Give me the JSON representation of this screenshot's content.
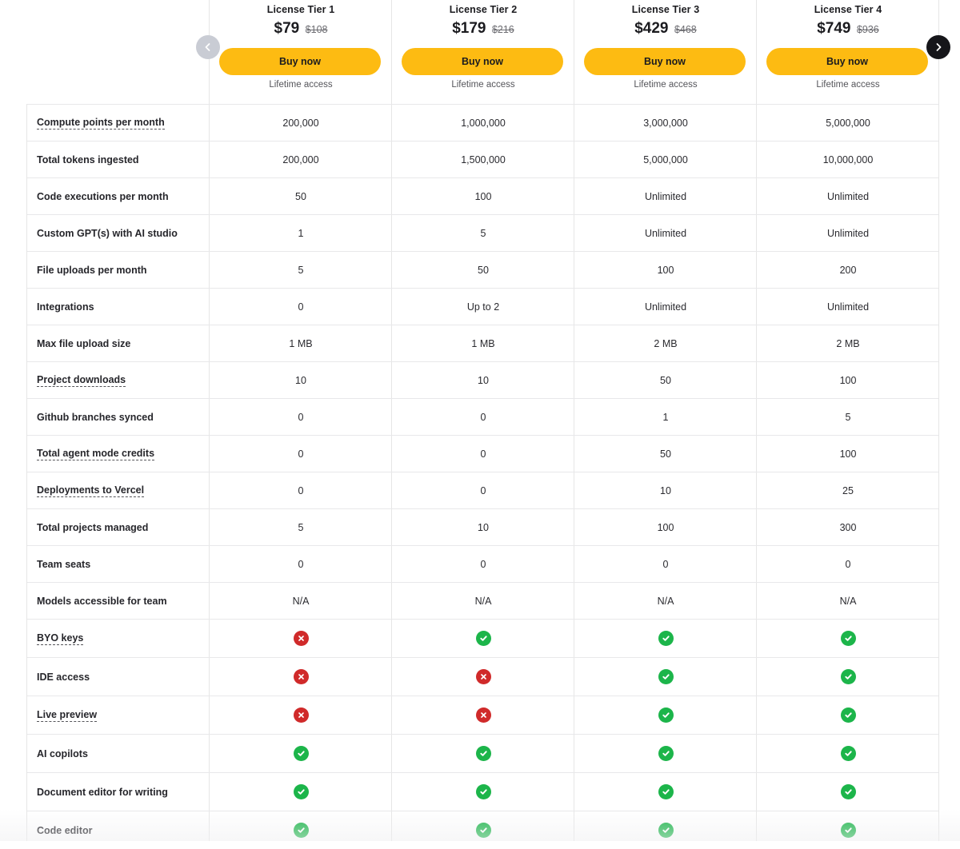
{
  "navigation": {
    "prev_icon": "chevron-left-icon",
    "next_icon": "chevron-right-icon"
  },
  "tiers": [
    {
      "name": "License Tier 1",
      "price": "$79",
      "original_price": "$108",
      "button": "Buy now",
      "note": "Lifetime access"
    },
    {
      "name": "License Tier 2",
      "price": "$179",
      "original_price": "$216",
      "button": "Buy now",
      "note": "Lifetime access"
    },
    {
      "name": "License Tier 3",
      "price": "$429",
      "original_price": "$468",
      "button": "Buy now",
      "note": "Lifetime access"
    },
    {
      "name": "License Tier 4",
      "price": "$749",
      "original_price": "$936",
      "button": "Buy now",
      "note": "Lifetime access"
    }
  ],
  "features": [
    {
      "label": "Compute points per month",
      "tooltip": true,
      "values": [
        "200,000",
        "1,000,000",
        "3,000,000",
        "5,000,000"
      ]
    },
    {
      "label": "Total tokens ingested",
      "tooltip": false,
      "values": [
        "200,000",
        "1,500,000",
        "5,000,000",
        "10,000,000"
      ]
    },
    {
      "label": "Code executions per month",
      "tooltip": false,
      "values": [
        "50",
        "100",
        "Unlimited",
        "Unlimited"
      ]
    },
    {
      "label": "Custom GPT(s) with AI studio",
      "tooltip": false,
      "values": [
        "1",
        "5",
        "Unlimited",
        "Unlimited"
      ]
    },
    {
      "label": "File uploads per month",
      "tooltip": false,
      "values": [
        "5",
        "50",
        "100",
        "200"
      ]
    },
    {
      "label": "Integrations",
      "tooltip": false,
      "values": [
        "0",
        "Up to 2",
        "Unlimited",
        "Unlimited"
      ]
    },
    {
      "label": "Max file upload size",
      "tooltip": false,
      "values": [
        "1 MB",
        "1 MB",
        "2 MB",
        "2 MB"
      ]
    },
    {
      "label": "Project downloads",
      "tooltip": true,
      "values": [
        "10",
        "10",
        "50",
        "100"
      ]
    },
    {
      "label": "Github branches synced",
      "tooltip": false,
      "values": [
        "0",
        "0",
        "1",
        "5"
      ]
    },
    {
      "label": "Total agent mode credits",
      "tooltip": true,
      "values": [
        "0",
        "0",
        "50",
        "100"
      ]
    },
    {
      "label": "Deployments to Vercel",
      "tooltip": true,
      "values": [
        "0",
        "0",
        "10",
        "25"
      ]
    },
    {
      "label": "Total projects managed",
      "tooltip": false,
      "values": [
        "5",
        "10",
        "100",
        "300"
      ]
    },
    {
      "label": "Team seats",
      "tooltip": false,
      "values": [
        "0",
        "0",
        "0",
        "0"
      ]
    },
    {
      "label": "Models accessible for team",
      "tooltip": false,
      "values": [
        "N/A",
        "N/A",
        "N/A",
        "N/A"
      ]
    },
    {
      "label": "BYO keys",
      "tooltip": true,
      "included": [
        false,
        true,
        true,
        true
      ]
    },
    {
      "label": "IDE access",
      "tooltip": false,
      "included": [
        false,
        false,
        true,
        true
      ]
    },
    {
      "label": "Live preview",
      "tooltip": true,
      "included": [
        false,
        false,
        true,
        true
      ]
    },
    {
      "label": "AI copilots",
      "tooltip": false,
      "included": [
        true,
        true,
        true,
        true
      ]
    },
    {
      "label": "Document editor for writing",
      "tooltip": false,
      "included": [
        true,
        true,
        true,
        true
      ]
    },
    {
      "label": "Code editor",
      "tooltip": false,
      "included": [
        true,
        true,
        true,
        true
      ]
    }
  ],
  "colors": {
    "button": "#fdbb12",
    "check": "#1cb54a",
    "cross": "#d02a2a",
    "prev_arrow": "#c9ccd4",
    "next_arrow": "#16161a"
  }
}
